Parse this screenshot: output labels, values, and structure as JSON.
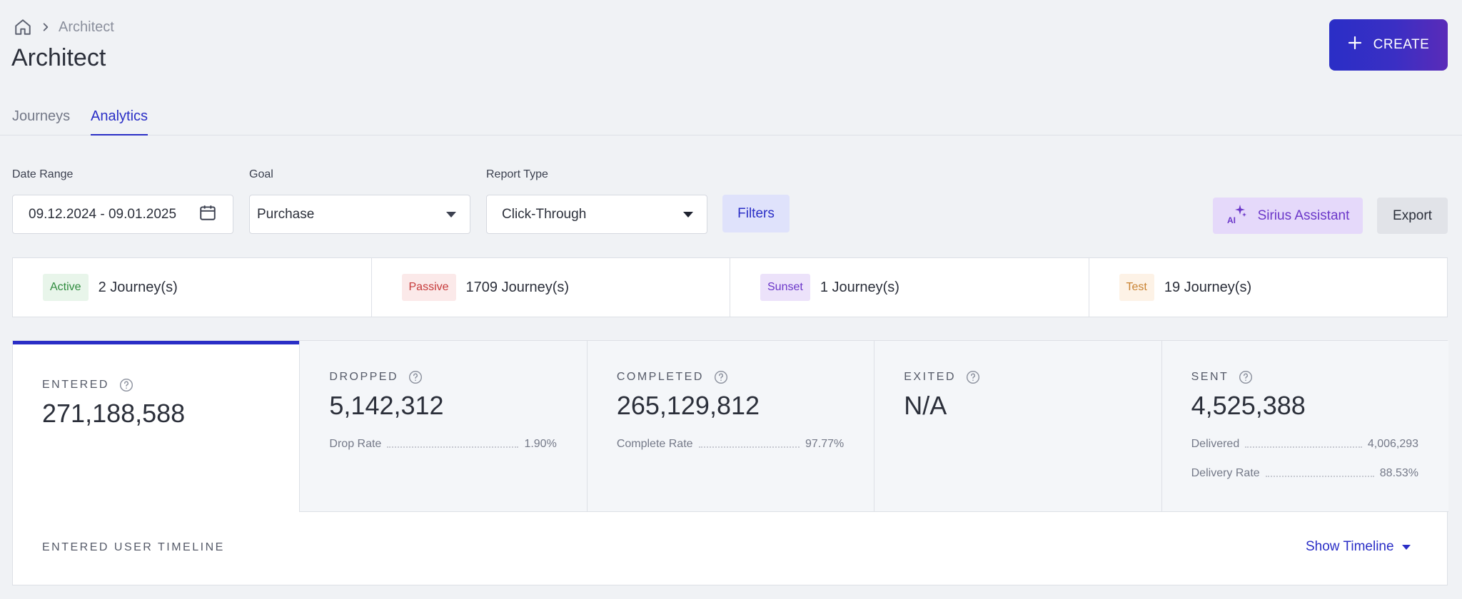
{
  "breadcrumb": {
    "current": "Architect"
  },
  "header": {
    "title": "Architect",
    "create_label": "CREATE"
  },
  "tabs": [
    {
      "label": "Journeys",
      "active": false
    },
    {
      "label": "Analytics",
      "active": true
    }
  ],
  "filters": {
    "date_range_label": "Date Range",
    "date_range_value": "09.12.2024 - 09.01.2025",
    "goal_label": "Goal",
    "goal_value": "Purchase",
    "report_type_label": "Report Type",
    "report_type_value": "Click-Through",
    "filters_label": "Filters",
    "sirius_label": "Sirius Assistant",
    "export_label": "Export"
  },
  "journey_status": [
    {
      "badge": "Active",
      "count": "2 Journey(s)",
      "badge_bg": "#e8f5ea",
      "badge_color": "#2e8b3d"
    },
    {
      "badge": "Passive",
      "count": "1709 Journey(s)",
      "badge_bg": "#fbe9e9",
      "badge_color": "#c63a3a"
    },
    {
      "badge": "Sunset",
      "count": "1 Journey(s)",
      "badge_bg": "#ece2fa",
      "badge_color": "#6b37c9"
    },
    {
      "badge": "Test",
      "count": "19 Journey(s)",
      "badge_bg": "#fdf2e6",
      "badge_color": "#c98333"
    }
  ],
  "metrics": [
    {
      "label": "ENTERED",
      "value": "271,188,588",
      "subs": []
    },
    {
      "label": "DROPPED",
      "value": "5,142,312",
      "subs": [
        {
          "label": "Drop Rate",
          "value": "1.90%"
        }
      ]
    },
    {
      "label": "COMPLETED",
      "value": "265,129,812",
      "subs": [
        {
          "label": "Complete Rate",
          "value": "97.77%"
        }
      ]
    },
    {
      "label": "EXITED",
      "value": "N/A",
      "subs": []
    },
    {
      "label": "SENT",
      "value": "4,525,388",
      "subs": [
        {
          "label": "Delivered",
          "value": "4,006,293"
        },
        {
          "label": "Delivery Rate",
          "value": "88.53%"
        }
      ]
    }
  ],
  "timeline": {
    "label": "ENTERED USER TIMELINE",
    "toggle_label": "Show Timeline"
  },
  "colors": {
    "accent": "#2a2ec6",
    "background": "#f0f2f5"
  },
  "icons": [
    "home-icon",
    "chevron-right-icon",
    "plus-icon",
    "calendar-icon",
    "caret-down-icon",
    "ai-sparkle-icon",
    "help-circle-icon"
  ]
}
